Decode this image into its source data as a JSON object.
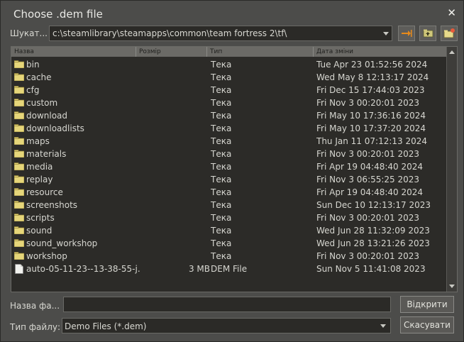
{
  "dialog": {
    "title": "Choose .dem file",
    "close_label": "✕"
  },
  "lookin": {
    "label": "Шукат...",
    "path": "c:\\steamlibrary\\steamapps\\common\\team fortress 2\\tf\\"
  },
  "columns": [
    "Назва",
    "Розмір",
    "Тип",
    "Дата зміни"
  ],
  "rows": [
    {
      "name": "bin",
      "size": "",
      "type": "Тека",
      "date": "Tue Apr 23 01:52:56 2024",
      "icon": "folder-icon"
    },
    {
      "name": "cache",
      "size": "",
      "type": "Тека",
      "date": "Wed May  8 12:13:17 2024",
      "icon": "folder-icon"
    },
    {
      "name": "cfg",
      "size": "",
      "type": "Тека",
      "date": "Fri Dec 15 17:44:03 2023",
      "icon": "folder-icon"
    },
    {
      "name": "custom",
      "size": "",
      "type": "Тека",
      "date": "Fri Nov  3 00:20:01 2023",
      "icon": "folder-icon"
    },
    {
      "name": "download",
      "size": "",
      "type": "Тека",
      "date": "Fri May 10 17:36:16 2024",
      "icon": "folder-icon"
    },
    {
      "name": "downloadlists",
      "size": "",
      "type": "Тека",
      "date": "Fri May 10 17:37:20 2024",
      "icon": "folder-icon"
    },
    {
      "name": "maps",
      "size": "",
      "type": "Тека",
      "date": "Thu Jan 11 07:12:13 2024",
      "icon": "folder-icon"
    },
    {
      "name": "materials",
      "size": "",
      "type": "Тека",
      "date": "Fri Nov  3 00:20:01 2023",
      "icon": "folder-icon"
    },
    {
      "name": "media",
      "size": "",
      "type": "Тека",
      "date": "Fri Apr 19 04:48:40 2024",
      "icon": "folder-icon"
    },
    {
      "name": "replay",
      "size": "",
      "type": "Тека",
      "date": "Fri Nov  3 06:55:25 2023",
      "icon": "folder-icon"
    },
    {
      "name": "resource",
      "size": "",
      "type": "Тека",
      "date": "Fri Apr 19 04:48:40 2024",
      "icon": "folder-icon"
    },
    {
      "name": "screenshots",
      "size": "",
      "type": "Тека",
      "date": "Sun Dec 10 12:13:17 2023",
      "icon": "folder-icon"
    },
    {
      "name": "scripts",
      "size": "",
      "type": "Тека",
      "date": "Fri Nov  3 00:20:01 2023",
      "icon": "folder-icon"
    },
    {
      "name": "sound",
      "size": "",
      "type": "Тека",
      "date": "Wed Jun 28 11:32:09 2023",
      "icon": "folder-icon"
    },
    {
      "name": "sound_workshop",
      "size": "",
      "type": "Тека",
      "date": "Wed Jun 28 13:21:26 2023",
      "icon": "folder-icon"
    },
    {
      "name": "workshop",
      "size": "",
      "type": "Тека",
      "date": "Fri Nov  3 00:20:01 2023",
      "icon": "folder-icon"
    },
    {
      "name": "auto-05-11-23--13-38-55-j.",
      "size": "3 MB",
      "type": "DEM File",
      "date": "Sun Nov  5 11:41:08 2023",
      "icon": "file-icon"
    }
  ],
  "filename": {
    "label": "Назва фа...",
    "value": ""
  },
  "filetype": {
    "label": "Тип файлу:",
    "value": "Demo Files (*.dem)"
  },
  "buttons": {
    "open": "Відкрити",
    "cancel": "Скасувати"
  },
  "colors": {
    "background": "#4c4c4a",
    "list_background": "#2c2b28",
    "folder": "#e8d878",
    "accent_orange": "#e88a1a"
  }
}
